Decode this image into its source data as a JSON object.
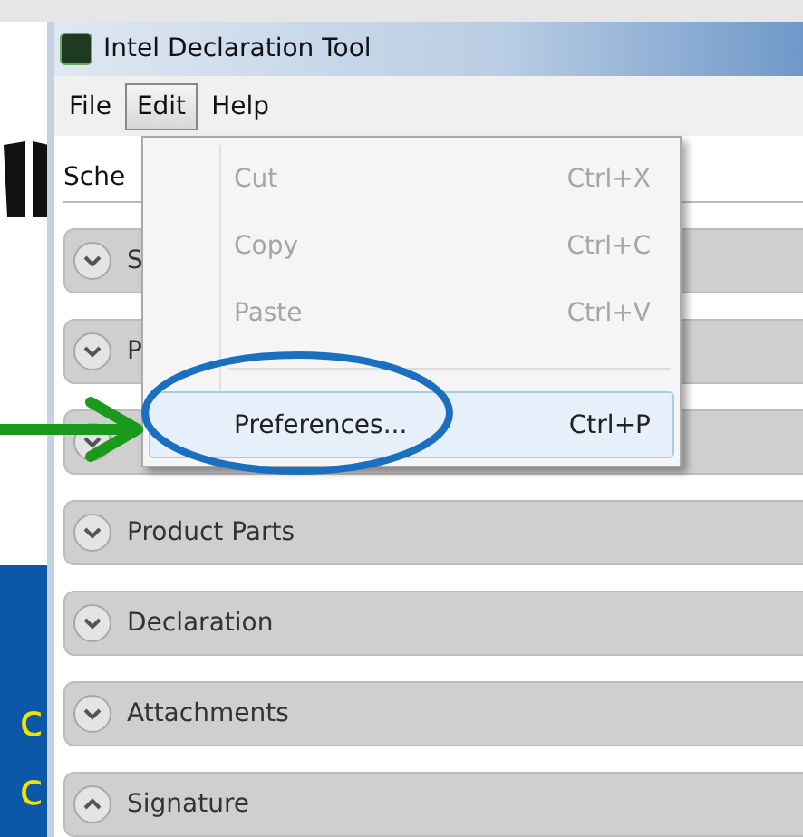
{
  "background": {
    "fragments": [
      "c",
      "c"
    ]
  },
  "window": {
    "title": "Intel Declaration Tool"
  },
  "menu_bar": [
    {
      "label": "File",
      "selected": false
    },
    {
      "label": "Edit",
      "selected": true
    },
    {
      "label": "Help",
      "selected": false
    }
  ],
  "field_label": "Sche",
  "sections": [
    {
      "title": "S",
      "expanded": false
    },
    {
      "title": "P",
      "expanded": false
    },
    {
      "expanded": false
    },
    {
      "title": "Product Parts",
      "expanded": false
    },
    {
      "title": "Declaration",
      "expanded": false
    },
    {
      "title": "Attachments",
      "expanded": false
    },
    {
      "title": "Signature",
      "expanded": true
    }
  ],
  "menu": {
    "items": [
      {
        "kind": "item",
        "label": "Cut",
        "shortcut": "Ctrl+X",
        "disabled": true,
        "selected": false
      },
      {
        "kind": "item",
        "label": "Copy",
        "shortcut": "Ctrl+C",
        "disabled": true,
        "selected": false
      },
      {
        "kind": "item",
        "label": "Paste",
        "shortcut": "Ctrl+V",
        "disabled": true,
        "selected": false
      },
      {
        "kind": "separator"
      },
      {
        "kind": "item",
        "label": "Preferences...",
        "shortcut": "Ctrl+P",
        "disabled": false,
        "selected": true
      }
    ]
  }
}
